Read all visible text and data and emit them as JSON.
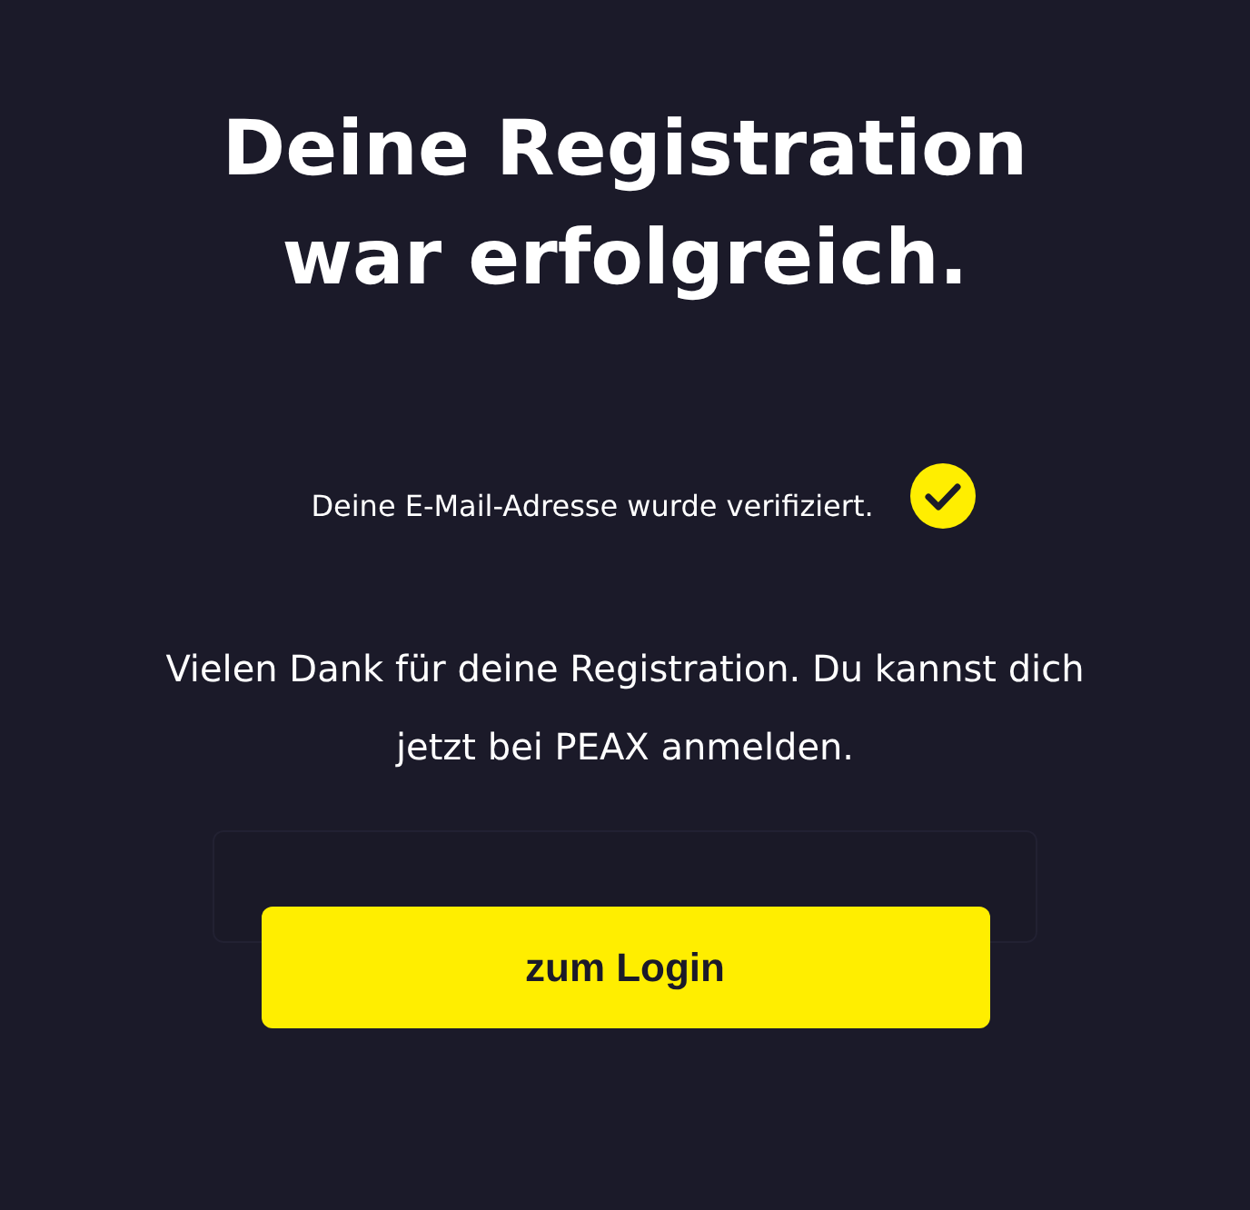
{
  "title": [
    "Deine Registration",
    "war erfolgreich."
  ],
  "verification": {
    "text": "Deine E-Mail-Adresse wurde verifiziert.",
    "verified": true
  },
  "message": "Vielen Dank für deine Registration. Du kannst dich jetzt bei PEAX anmelden.",
  "button": {
    "label": "zum Login"
  }
}
